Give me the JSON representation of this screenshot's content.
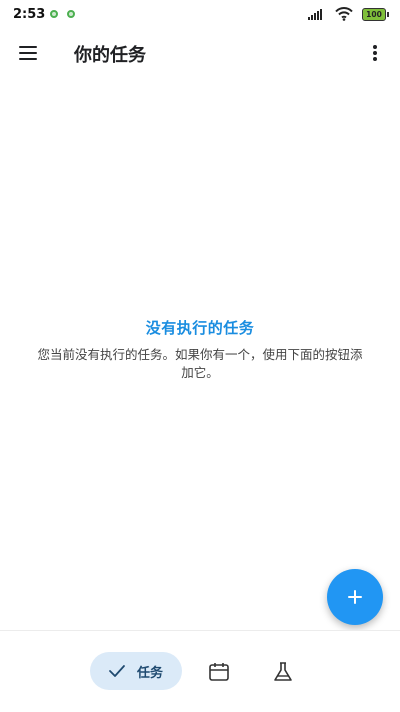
{
  "status_bar": {
    "time": "2:53",
    "battery": "100"
  },
  "app_bar": {
    "title": "你的任务",
    "menu_icon": "hamburger-menu-icon",
    "more_icon": "more-vertical-icon"
  },
  "empty_state": {
    "title": "没有执行的任务",
    "description": "您当前没有执行的任务。如果你有一个，使用下面的按钮添加它。"
  },
  "fab": {
    "icon": "plus-icon",
    "color": "#2196f3"
  },
  "bottom_nav": {
    "items": [
      {
        "label": "任务",
        "icon": "check-icon",
        "active": true
      },
      {
        "label": "",
        "icon": "calendar-icon",
        "active": false
      },
      {
        "label": "",
        "icon": "flask-icon",
        "active": false
      }
    ]
  },
  "colors": {
    "accent": "#1a8de0",
    "nav_active_bg": "#dbeaf8"
  }
}
